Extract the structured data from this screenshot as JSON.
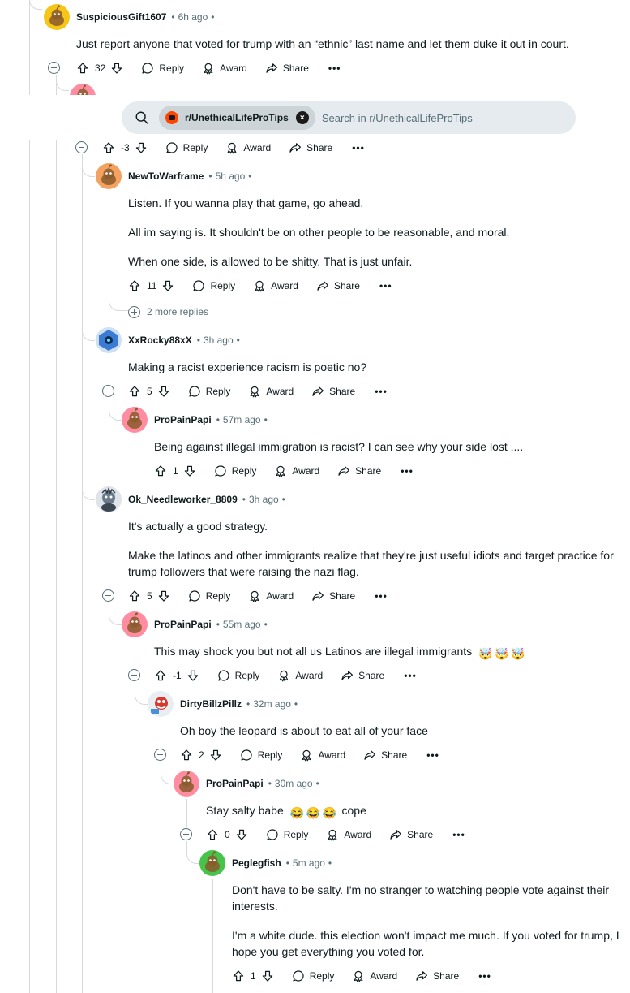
{
  "search": {
    "subreddit_chip": "r/UnethicalLifeProTips",
    "placeholder": "Search in r/UnethicalLifeProTips",
    "clear_symbol": "×"
  },
  "labels": {
    "reply": "Reply",
    "award": "Award",
    "share": "Share",
    "more": "•••",
    "dot": "•"
  },
  "comments": [
    {
      "id": "c1",
      "user": "SuspiciousGift1607",
      "time": "6h ago",
      "avatar_color": "#f5c518",
      "body": [
        "Just report anyone that voted for trump with an “ethnic” last name and let them duke it out in court."
      ],
      "votes": "32"
    },
    {
      "id": "c2-hidden",
      "user": "ProPainPapi",
      "avatar_color": "#ff8da1",
      "votes": "-3"
    },
    {
      "id": "c3",
      "user": "NewToWarframe",
      "time": "5h ago",
      "avatar_color": "#f4a261",
      "body": [
        "Listen. If you wanna play that game, go ahead.",
        "All im saying is. It shouldn't be on other people to be reasonable, and moral.",
        "When one side, is allowed to be shitty. That is just unfair."
      ],
      "votes": "11"
    },
    {
      "id": "c4",
      "user": "XxRocky88xX",
      "time": "3h ago",
      "avatar_color": "#3a7bd5",
      "body": [
        "Making a racist experience racism is poetic no?"
      ],
      "votes": "5"
    },
    {
      "id": "c5",
      "user": "ProPainPapi",
      "time": "57m ago",
      "avatar_color": "#ff8da1",
      "body": [
        "Being against illegal immigration is racist? I can see why your side lost ...."
      ],
      "votes": "1"
    },
    {
      "id": "c6",
      "user": "Ok_Needleworker_8809",
      "time": "3h ago",
      "avatar_color": "#6b7b8c",
      "body": [
        "It's actually a good strategy.",
        "Make the latinos and other immigrants realize that they're just useful idiots and target practice for trump followers that were raising the nazi flag."
      ],
      "votes": "5"
    },
    {
      "id": "c7",
      "user": "ProPainPapi",
      "time": "55m ago",
      "avatar_color": "#ff8da1",
      "body": [
        "This may shock you but not all us Latinos are illegal immigrants"
      ],
      "emojis": [
        "🤯",
        "🤯",
        "🤯"
      ],
      "votes": "-1"
    },
    {
      "id": "c8",
      "user": "DirtyBillzPillz",
      "time": "32m ago",
      "avatar_color": "#d63a2f",
      "body": [
        "Oh boy the leopard is about to eat all of your face"
      ],
      "votes": "2"
    },
    {
      "id": "c9",
      "user": "ProPainPapi",
      "time": "30m ago",
      "avatar_color": "#ff8da1",
      "body": [
        "Stay salty babe",
        "cope"
      ],
      "emojis": [
        "😂",
        "😂",
        "😂"
      ],
      "votes": "0"
    },
    {
      "id": "c10",
      "user": "Peglegfish",
      "time": "5m ago",
      "avatar_color": "#46c34a",
      "body": [
        "Don't have to be salty. I'm no stranger to watching people vote against their interests.",
        "I'm a white dude. this election won't impact me much. If you voted for trump, I hope you get everything you voted for."
      ],
      "votes": "1"
    }
  ],
  "more_replies": "2 more replies",
  "icons": [
    "search-icon",
    "upvote-icon",
    "downvote-icon",
    "comment-icon",
    "award-icon",
    "share-icon",
    "collapse-icon",
    "expand-icon",
    "snoo-avatar-icon"
  ]
}
